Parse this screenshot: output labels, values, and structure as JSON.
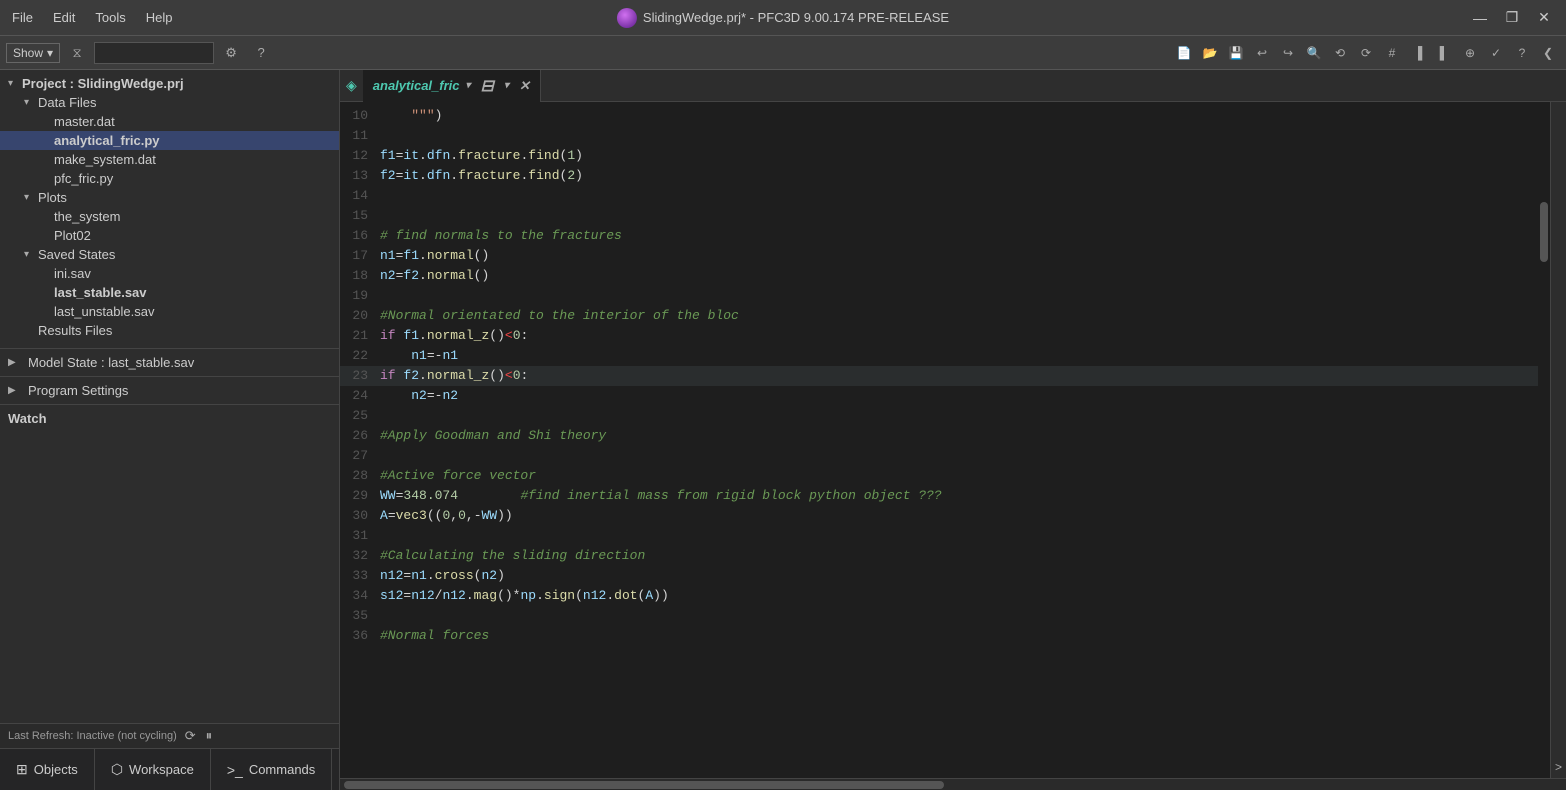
{
  "titlebar": {
    "icon": "◈",
    "title": "SlidingWedge.prj* - PFC3D 9.00.174 PRE-RELEASE",
    "menus": [
      "File",
      "Edit",
      "Tools",
      "Help"
    ],
    "controls": [
      "—",
      "❐",
      "✕"
    ]
  },
  "toolbar": {
    "show_label": "Show",
    "filter_placeholder": "",
    "buttons_right": [
      "📄",
      "📂",
      "💾",
      "↩",
      "↪",
      "🔍",
      "⟲",
      "⟳",
      "#",
      "❚",
      "❚",
      "⊕",
      "✓",
      "?",
      "❮"
    ]
  },
  "sidebar": {
    "project_label": "Project : SlidingWedge.prj",
    "data_files_label": "Data Files",
    "files": [
      "master.dat",
      "analytical_fric.py",
      "make_system.dat",
      "pfc_fric.py"
    ],
    "selected_file": "analytical_fric.py",
    "plots_label": "Plots",
    "plots": [
      "the_system",
      "Plot02"
    ],
    "saved_states_label": "Saved States",
    "saved_states": [
      "ini.sav",
      "last_stable.sav",
      "last_unstable.sav"
    ],
    "selected_state": "last_stable.sav",
    "results_label": "Results Files",
    "model_state_label": "Model State : last_stable.sav",
    "program_settings_label": "Program Settings",
    "watch_label": "Watch",
    "last_refresh": "Last Refresh: Inactive (not cycling)"
  },
  "editor": {
    "tab_name": "analytical_fric",
    "lines": [
      {
        "num": "10",
        "content": "    \"\"\""
      },
      {
        "num": "11",
        "content": ""
      },
      {
        "num": "12",
        "content": "f1=it.dfn.fracture.find(1)"
      },
      {
        "num": "13",
        "content": "f2=it.dfn.fracture.find(2)"
      },
      {
        "num": "14",
        "content": ""
      },
      {
        "num": "15",
        "content": ""
      },
      {
        "num": "16",
        "content": "# find normals to the fractures"
      },
      {
        "num": "17",
        "content": "n1=f1.normal()"
      },
      {
        "num": "18",
        "content": "n2=f2.normal()"
      },
      {
        "num": "19",
        "content": ""
      },
      {
        "num": "20",
        "content": "#Normal orientated to the interior of the bloc"
      },
      {
        "num": "21",
        "content": "if f1.normal_z()<0:"
      },
      {
        "num": "22",
        "content": "    n1=-n1"
      },
      {
        "num": "23",
        "content": "if f2.normal_z()<0:"
      },
      {
        "num": "24",
        "content": "    n2=-n2"
      },
      {
        "num": "25",
        "content": ""
      },
      {
        "num": "26",
        "content": "#Apply Goodman and Shi theory"
      },
      {
        "num": "27",
        "content": ""
      },
      {
        "num": "28",
        "content": "#Active force vector"
      },
      {
        "num": "29",
        "content": "WW=348.074        #find inertial mass from rigid block python object ???"
      },
      {
        "num": "30",
        "content": "A=vec3((0,0,-WW))"
      },
      {
        "num": "31",
        "content": ""
      },
      {
        "num": "32",
        "content": "#Calculating the sliding direction"
      },
      {
        "num": "33",
        "content": "n12=n1.cross(n2)"
      },
      {
        "num": "34",
        "content": "s12=n12/n12.mag()*np.sign(n12.dot(A))"
      },
      {
        "num": "35",
        "content": ""
      },
      {
        "num": "36",
        "content": "#Normal forces"
      }
    ]
  },
  "bottom_tabs": [
    {
      "icon": "⊞",
      "label": "Objects"
    },
    {
      "icon": "⬡",
      "label": "Workspace"
    },
    {
      "icon": ">_",
      "label": "Commands"
    }
  ]
}
